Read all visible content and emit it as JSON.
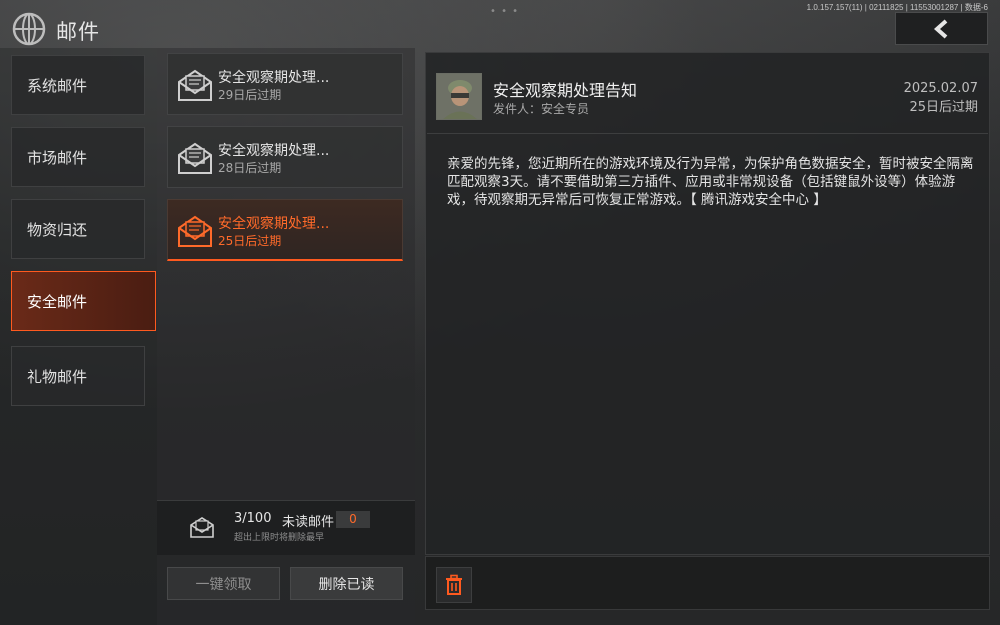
{
  "app": {
    "title": "邮件",
    "version": "1.0.157.157(11) | 02111825 | 11553001287 | 数据-6"
  },
  "colors": {
    "accent": "#ff5a1f",
    "background": "#2b2c2d"
  },
  "sidebar": {
    "items": [
      {
        "label": "系统邮件",
        "active": false
      },
      {
        "label": "市场邮件",
        "active": false
      },
      {
        "label": "物资归还",
        "active": false
      },
      {
        "label": "安全邮件",
        "active": true
      },
      {
        "label": "礼物邮件",
        "active": false
      }
    ]
  },
  "mail_list": {
    "items": [
      {
        "title": "安全观察期处理...",
        "expiry": "29日后过期",
        "icon": "envelope-open-icon",
        "active": false
      },
      {
        "title": "安全观察期处理...",
        "expiry": "28日后过期",
        "icon": "envelope-open-icon",
        "active": false
      },
      {
        "title": "安全观察期处理...",
        "expiry": "25日后过期",
        "icon": "envelope-open-icon",
        "active": true
      }
    ],
    "unread": {
      "count": "3/100",
      "label": "未读邮件",
      "badge": "0",
      "note": "超出上限时将删除最早"
    },
    "claim_all_label": "一键领取",
    "delete_read_label": "删除已读"
  },
  "detail": {
    "title": "安全观察期处理告知",
    "sender": "发件人：安全专员",
    "date": "2025.02.07",
    "expiry": "25日后过期",
    "body": "亲爱的先锋，您近期所在的游戏环境及行为异常，为保护角色数据安全，暂时被安全隔离匹配观察3天。请不要借助第三方插件、应用或非常规设备（包括键鼠外设等）体验游戏，待观察期无异常后可恢复正常游戏。【 腾讯游戏安全中心 】"
  },
  "icons": {
    "back": "back-arrow-icon",
    "delete": "trash-icon",
    "logo": "globe-logo-icon"
  }
}
